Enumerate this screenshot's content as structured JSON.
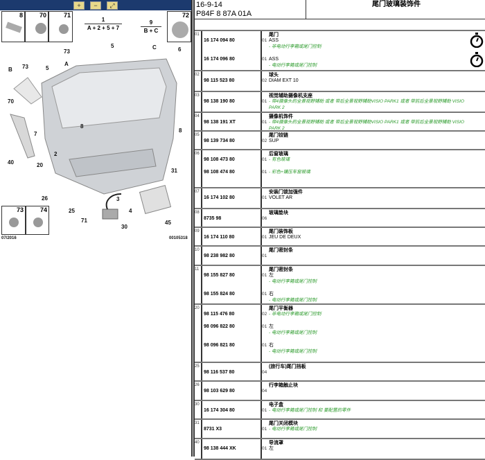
{
  "toolbar": {
    "zoom_in": "zoom-in-icon",
    "zoom_out": "zoom-out-icon",
    "zoom_fit": "zoom-fit-icon"
  },
  "diagram": {
    "thumbs_top": [
      "8",
      "70",
      "71",
      "72"
    ],
    "thumbs_bottom": [
      "73",
      "74"
    ],
    "formula1_top": "1",
    "formula1_bottom": "A + 2 + 5 + 7",
    "formula2_top": "9",
    "formula2_bottom": "B + C",
    "callouts": [
      "73",
      "5",
      "C",
      "6",
      "B",
      "73",
      "5",
      "A",
      "70",
      "8",
      "8",
      "7",
      "40",
      "20",
      "2",
      "31",
      "26",
      "25",
      "3",
      "4",
      "71",
      "30",
      "45"
    ],
    "date": "07/2016",
    "ref": "00105318"
  },
  "header": {
    "date": "16-9-14",
    "code": "P84F 8 87A 01A",
    "title": "尾门玻璃装饰件"
  },
  "rows": [
    {
      "idx": "01",
      "title": "尾门",
      "items": [
        {
          "pn": "16 174 094 80",
          "qty": "01",
          "text": "ASS",
          "note": "- 非电动行李箱或尾门控制"
        },
        {
          "pn": "16 174 096 80",
          "qty": "01",
          "text": "ASS",
          "note": "- 电动行李箱或尾门控制"
        }
      ]
    },
    {
      "idx": "02",
      "title": "球头",
      "items": [
        {
          "pn": "98 115 523 80",
          "qty": "02",
          "text": "DIAM EXT 10"
        }
      ]
    },
    {
      "idx": "03",
      "title": "视觉辅助摄像机支座",
      "items": [
        {
          "pn": "98 138 190 80",
          "qty": "01",
          "note": "- 带4摄像头的全景视野辅助 或者 带后全景视野辅助VISIO PARK1 或者 带前后全景视野辅助 VISIO PARK 2"
        }
      ]
    },
    {
      "idx": "04",
      "title": "摄像机饰件",
      "items": [
        {
          "pn": "98 138 191 XT",
          "qty": "01",
          "note": "- 带4摄像头的全景视野辅助 或者 带后全景视野辅助VISIO PARK1 或者 带前后全景视野辅助 VISIO PARK 2"
        }
      ]
    },
    {
      "idx": "05",
      "title": "尾门铰链",
      "items": [
        {
          "pn": "98 139 734 80",
          "qty": "02",
          "text": "SUP"
        }
      ]
    },
    {
      "idx": "06",
      "title": "后窗玻璃",
      "items": [
        {
          "pn": "98 108 473 80",
          "qty": "01",
          "note": "- 有色玻璃"
        },
        {
          "pn": "98 108 474 80",
          "qty": "01",
          "note": "- 彩色+镶压车窗玻璃"
        }
      ]
    },
    {
      "idx": "07",
      "title": "安装门锁加强件",
      "items": [
        {
          "pn": "16 174 102 80",
          "qty": "01",
          "text": "VOLET AR"
        }
      ]
    },
    {
      "idx": "08",
      "title": "玻璃垫块",
      "items": [
        {
          "pn": "8735 98",
          "qty": "06"
        }
      ]
    },
    {
      "idx": "09",
      "title": "尾门装饰板",
      "items": [
        {
          "pn": "16 174 110 80",
          "qty": "01",
          "text": "JEU DE DEUX"
        }
      ]
    },
    {
      "idx": "10",
      "title": "尾门密封条",
      "items": [
        {
          "pn": "98 238 982 80",
          "qty": "01"
        }
      ]
    },
    {
      "idx": "11",
      "title": "尾门密封条",
      "items": [
        {
          "pn": "98 155 827 80",
          "qty": "01",
          "text": "左",
          "note": "- 电动行李箱或尾门控制"
        },
        {
          "pn": "98 155 824 80",
          "qty": "01",
          "text": "右",
          "note": "- 电动行李箱或尾门控制"
        }
      ]
    },
    {
      "idx": "20",
      "title": "尾门平衡器",
      "items": [
        {
          "pn": "98 115 476 80",
          "qty": "02",
          "note": "- 非电动行李箱或尾门控制"
        },
        {
          "pn": "98 096 822 80",
          "qty": "01",
          "text": "左",
          "note": "- 电动行李箱或尾门控制"
        },
        {
          "pn": "98 096 821 80",
          "qty": "01",
          "text": "右",
          "note": "- 电动行李箱或尾门控制"
        }
      ]
    },
    {
      "idx": "25",
      "title": "(旅行车)尾门挡板",
      "items": [
        {
          "pn": "98 116 537 80",
          "qty": "04"
        }
      ]
    },
    {
      "idx": "26",
      "title": "行李箱触止块",
      "items": [
        {
          "pn": "98 103 629 80",
          "qty": "04"
        }
      ]
    },
    {
      "idx": "30",
      "title": "电子盒",
      "items": [
        {
          "pn": "16 174 304 80",
          "qty": "01",
          "note": "- 电动行李箱或尾门控制 和 要配置的零件"
        }
      ]
    },
    {
      "idx": "31",
      "title": "尾门关闭模块",
      "items": [
        {
          "pn": "8731 X3",
          "qty": "01",
          "note": "- 电动行李箱或尾门控制"
        }
      ]
    },
    {
      "idx": "40",
      "title": "导流罩",
      "items": [
        {
          "pn": "98 138 444 XK",
          "qty": "01",
          "text": "左"
        }
      ]
    }
  ]
}
